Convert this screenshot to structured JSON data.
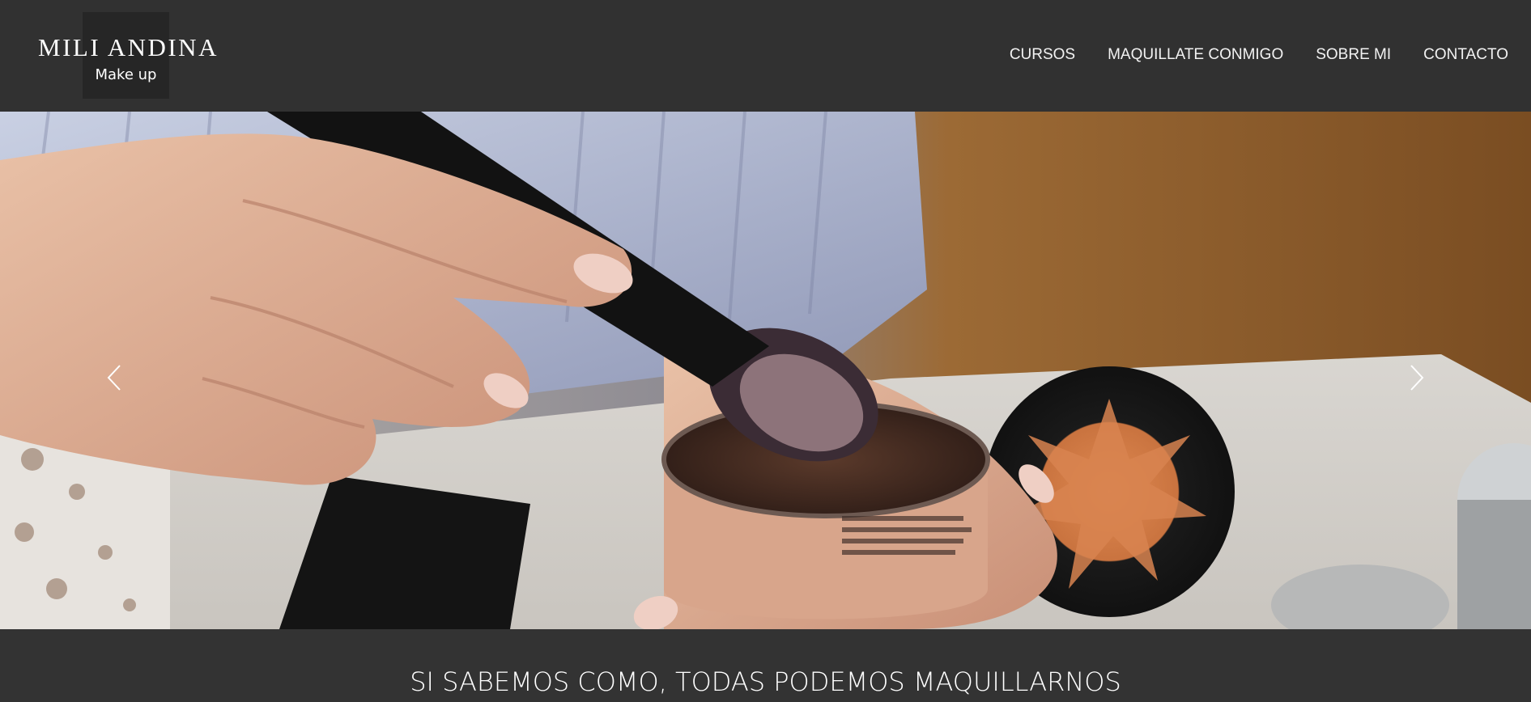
{
  "brand": {
    "name": "MILI ANDINA",
    "sub": "Make up"
  },
  "nav": {
    "items": [
      {
        "label": "CURSOS"
      },
      {
        "label": "MAQUILLATE CONMIGO"
      },
      {
        "label": "SOBRE MI"
      },
      {
        "label": "CONTACTO"
      }
    ]
  },
  "hero": {
    "prev_icon": "chevron-left-icon",
    "next_icon": "chevron-right-icon"
  },
  "tagline": "SI SABEMOS COMO, TODAS PODEMOS MAQUILLARNOS",
  "colors": {
    "header_bg": "#313131",
    "logo_box": "#262626",
    "text": "#ffffff"
  }
}
